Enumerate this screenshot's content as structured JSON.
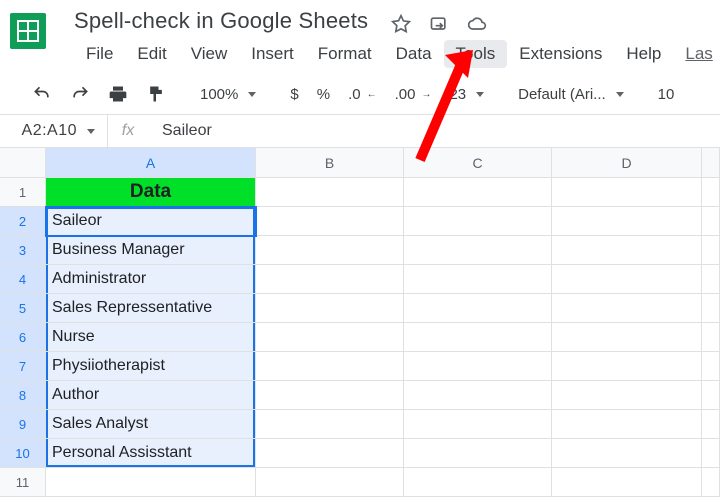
{
  "doc": {
    "title": "Spell-check in Google Sheets"
  },
  "menus": {
    "items": [
      "File",
      "Edit",
      "View",
      "Insert",
      "Format",
      "Data",
      "Tools",
      "Extensions",
      "Help"
    ],
    "last": "Las"
  },
  "toolbar": {
    "zoom": "100%",
    "currency": "$",
    "percent": "%",
    "decDec": ".0",
    "incDec": ".00",
    "fmt": "23",
    "font": "Default (Ari...",
    "size": "10"
  },
  "nameBox": {
    "ref": "A2:A10",
    "formula": "Saileor"
  },
  "columns": [
    "A",
    "B",
    "C",
    "D"
  ],
  "rows": [
    "1",
    "2",
    "3",
    "4",
    "5",
    "6",
    "7",
    "8",
    "9",
    "10",
    "11"
  ],
  "data": {
    "header": "Data",
    "valuesA": [
      "Saileor",
      "Business Manager",
      "Administrator",
      "Sales Repressentative",
      "Nurse",
      "Physiiotherapist",
      "Author",
      "Sales Analyst",
      "Personal Assisstant"
    ]
  }
}
